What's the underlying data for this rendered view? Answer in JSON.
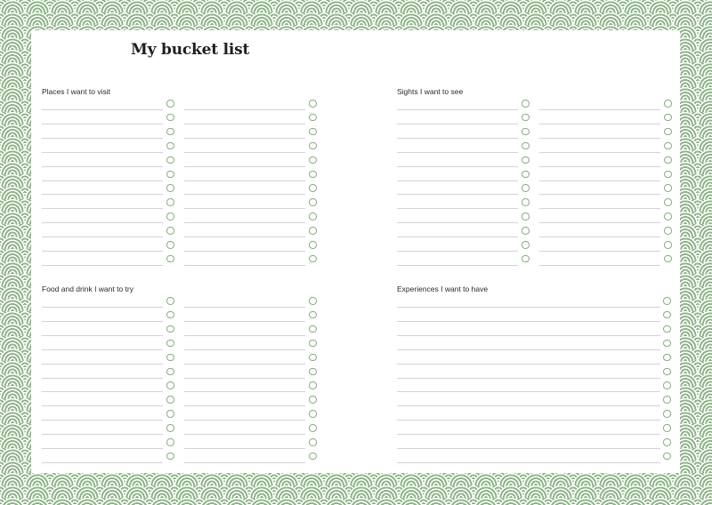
{
  "title": "My bucket list",
  "colors": {
    "pattern_green": "#8fb489",
    "checkbox_green": "#88ad7f",
    "line_gray": "#d3d3d3",
    "text": "#1f1f1f"
  },
  "sections": [
    {
      "id": "places",
      "label": "Places I want to visit",
      "columns": 2,
      "rows_per_column": 12,
      "checkbox_icon": "circle-checkbox-icon"
    },
    {
      "id": "sights",
      "label": "Sights I want to see",
      "columns": 2,
      "rows_per_column": 12,
      "checkbox_icon": "circle-checkbox-icon"
    },
    {
      "id": "food",
      "label": "Food and drink I want to try",
      "columns": 2,
      "rows_per_column": 12,
      "checkbox_icon": "circle-checkbox-icon"
    },
    {
      "id": "experiences",
      "label": "Experiences I want to have",
      "columns": 1,
      "rows_per_column": 12,
      "checkbox_icon": "circle-checkbox-icon"
    }
  ]
}
